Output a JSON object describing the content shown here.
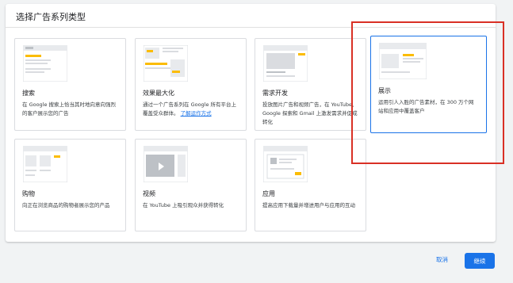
{
  "panel": {
    "title": "选择广告系列类型"
  },
  "cards": [
    {
      "title": "搜索",
      "desc": "在 Google 搜索上恰当其时地向意向强烈的客户展示您的广告",
      "link": ""
    },
    {
      "title": "效果最大化",
      "desc": "通过一个广告系列在 Google 所有平台上覆盖受众群体。",
      "link": "了解运作方式"
    },
    {
      "title": "需求开发",
      "desc": "投放图片广告和视频广告，在 YouTube、Google 探索和 Gmail 上激发需求并促成转化",
      "link": ""
    },
    {
      "title": "展示",
      "desc": "运用引人入胜的广告素材，在 300 万个网站和应用中覆盖客户",
      "link": ""
    },
    {
      "title": "购物",
      "desc": "向正在浏览商品的购物者展示您的产品",
      "link": ""
    },
    {
      "title": "视频",
      "desc": "在 YouTube 上吸引观众并获得转化",
      "link": ""
    },
    {
      "title": "应用",
      "desc": "提高应用下载量并增进用户与应用的互动",
      "link": ""
    }
  ],
  "actions": {
    "cancel": "取消",
    "continue": "继续"
  },
  "colors": {
    "accent": "#1a73e8",
    "highlight": "#d93025",
    "thumb_yellow": "#fbbc04"
  }
}
